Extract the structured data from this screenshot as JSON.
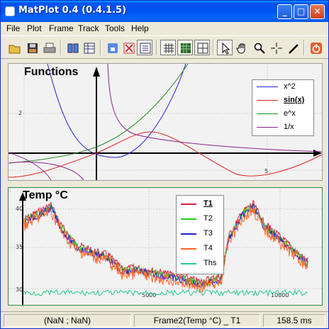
{
  "window": {
    "title": "MatPlot 0.4 (0.4.1.5)"
  },
  "menu": [
    "File",
    "Plot",
    "Frame",
    "Track",
    "Tools",
    "Help"
  ],
  "toolbar_icons": [
    "open-icon",
    "save-icon",
    "print-icon",
    "book-icon",
    "table-icon",
    "lock-icon",
    "autoscale-icon",
    "list-icon",
    "grid-icon",
    "grid-fine-icon",
    "grid-box-icon",
    "pointer-icon",
    "hand-icon",
    "zoom-icon",
    "crosshair-icon",
    "pen-icon",
    "power-icon"
  ],
  "plot1": {
    "title": "Functions",
    "tick_y": "2",
    "tick_x": "5",
    "legend": [
      {
        "label": "x^2",
        "color": "#2222cc"
      },
      {
        "label": "sin(x)",
        "color": "#dd2222",
        "bold": true
      },
      {
        "label": "e^x",
        "color": "#228822"
      },
      {
        "label": "1/x",
        "color": "#882288"
      }
    ]
  },
  "plot2": {
    "title": "Temp °C",
    "tick_y_hi": "40",
    "tick_y_mid": "35",
    "tick_y_lo": "30",
    "tick_x1": "5000",
    "tick_x2": "10000",
    "legend": [
      {
        "label": "T1",
        "color": "#dd2244",
        "bold": true
      },
      {
        "label": "T2",
        "color": "#22cc22"
      },
      {
        "label": "T3",
        "color": "#2222cc"
      },
      {
        "label": "T4",
        "color": "#ff6622"
      },
      {
        "label": "Ths",
        "color": "#22cc88"
      }
    ]
  },
  "status": {
    "coords": "(NaN ; NaN)",
    "frame": "Frame2(Temp °C) _ T1",
    "time": "158.5 ms"
  }
}
